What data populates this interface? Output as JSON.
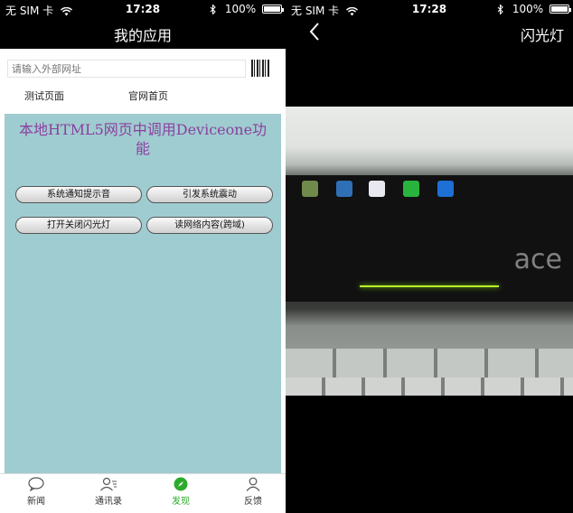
{
  "left": {
    "status": {
      "carrier": "无 SIM 卡",
      "time": "17:28",
      "battery": "100%",
      "battery_level": 1.0
    },
    "nav_title": "我的应用",
    "url_placeholder": "请输入外部网址",
    "links": [
      "测试页面",
      "官网首页"
    ],
    "web": {
      "heading": "本地HTML5网页中调用Deviceone功能",
      "background": "#9fccd0",
      "heading_color": "#8b3fa0",
      "buttons": [
        "系统通知提示音",
        "引发系统震动",
        "打开关闭闪光灯",
        "读网络内容(跨域)"
      ]
    },
    "tabs": [
      {
        "label": "新闻",
        "icon": "chat-bubble-icon"
      },
      {
        "label": "通讯录",
        "icon": "contacts-icon"
      },
      {
        "label": "发现",
        "icon": "compass-icon"
      },
      {
        "label": "反馈",
        "icon": "person-icon"
      }
    ],
    "active_tab": "发现",
    "accent": "#2eaa2e"
  },
  "right": {
    "status": {
      "carrier": "无 SIM 卡",
      "time": "17:28",
      "battery": "100%",
      "battery_level": 1.0
    },
    "back_icon": "chevron-left-icon",
    "nav_action": "闪光灯"
  }
}
